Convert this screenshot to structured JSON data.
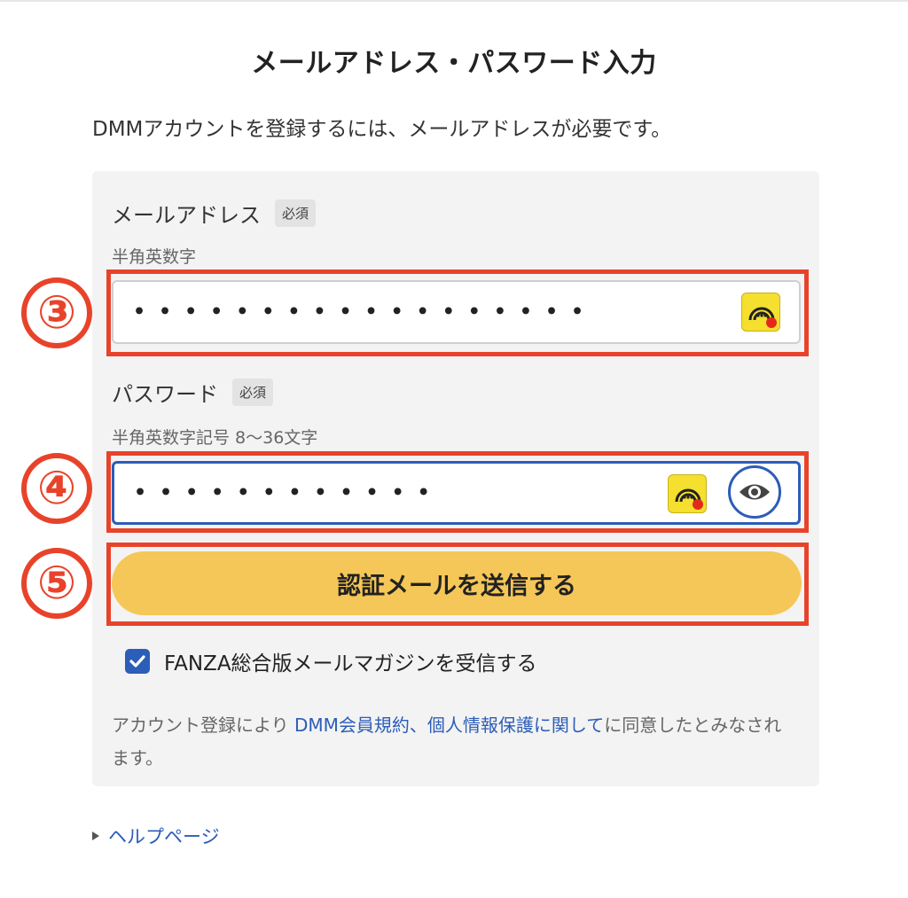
{
  "page": {
    "title": "メールアドレス・パスワード入力",
    "intro": "DMMアカウントを登録するには、メールアドレスが必要です。"
  },
  "email": {
    "label": "メールアドレス",
    "required": "必須",
    "hint": "半角英数字",
    "masked_value": "••••••••••••••••••"
  },
  "password": {
    "label": "パスワード",
    "required": "必須",
    "hint": "半角英数字記号 8〜36文字",
    "masked_value": "••••••••••••"
  },
  "submit": {
    "label": "認証メールを送信する"
  },
  "newsletter": {
    "label": "FANZA総合版メールマガジンを受信する",
    "checked": true
  },
  "terms": {
    "prefix": "アカウント登録により ",
    "link1": "DMM会員規約",
    "sep": "、",
    "link2": "個人情報保護に関して",
    "suffix": "に同意したとみなされます。"
  },
  "help": {
    "label": "ヘルプページ"
  },
  "annotations": [
    "③",
    "④",
    "⑤"
  ],
  "colors": {
    "callout": "#e8432a",
    "accent_blue": "#2c5db8",
    "button_yellow": "#f5c758",
    "card_bg": "#f3f3f3"
  },
  "icons": [
    "password-manager-icon",
    "eye-icon",
    "checkmark-icon",
    "triangle-right-icon"
  ]
}
